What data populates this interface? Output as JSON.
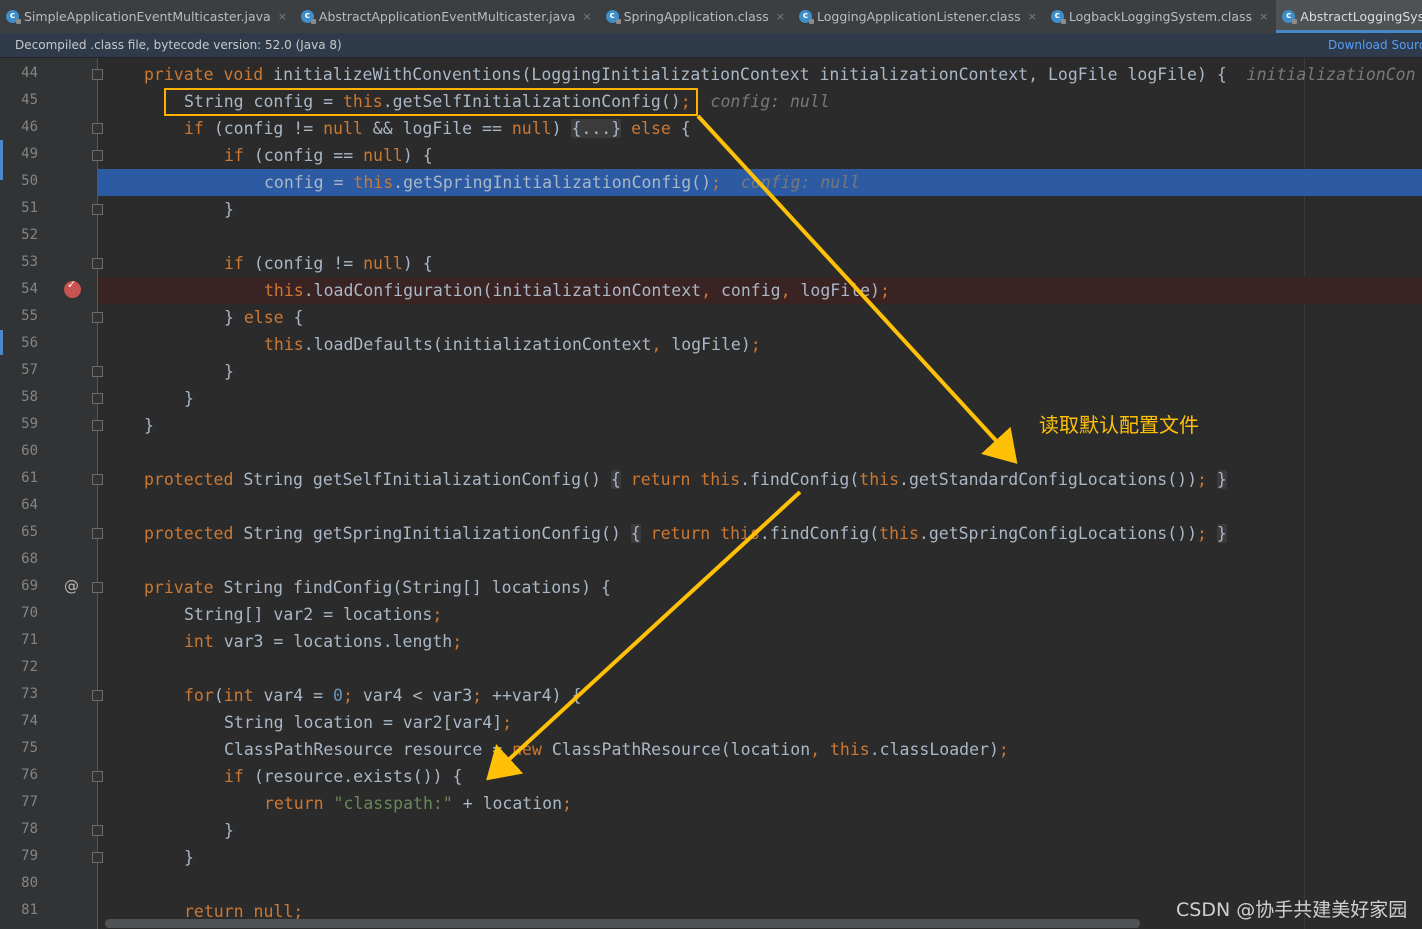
{
  "tabs": [
    {
      "label": "SimpleApplicationEventMulticaster.java",
      "active": false
    },
    {
      "label": "AbstractApplicationEventMulticaster.java",
      "active": false
    },
    {
      "label": "SpringApplication.class",
      "active": false
    },
    {
      "label": "LoggingApplicationListener.class",
      "active": false
    },
    {
      "label": "LogbackLoggingSystem.class",
      "active": false
    },
    {
      "label": "AbstractLoggingSystem.class",
      "active": true
    }
  ],
  "tab_close_glyph": "×",
  "infobar": {
    "message": "Decompiled .class file, bytecode version: 52.0 (Java 8)",
    "download_label": "Download Sourc"
  },
  "line_numbers": [
    "44",
    "45",
    "46",
    "49",
    "50",
    "51",
    "52",
    "53",
    "54",
    "55",
    "56",
    "57",
    "58",
    "59",
    "60",
    "61",
    "64",
    "65",
    "68",
    "69",
    "70",
    "71",
    "72",
    "73",
    "74",
    "75",
    "76",
    "77",
    "78",
    "79",
    "80",
    "81"
  ],
  "annotation_text": "读取默认配置文件",
  "watermark": "CSDN @协手共建美好家园",
  "colors": {
    "editor_bg": "#2b2b2b",
    "keyword": "#cc7832",
    "string": "#6a8759",
    "number": "#6897bb",
    "execution_line": "#2d5ba3",
    "breakpoint_line": "#3a2323",
    "annotation": "#ffc107"
  },
  "icons": [
    "class-file-icon",
    "close-icon",
    "breakpoint-icon",
    "implements-at-icon",
    "fold-icon"
  ]
}
